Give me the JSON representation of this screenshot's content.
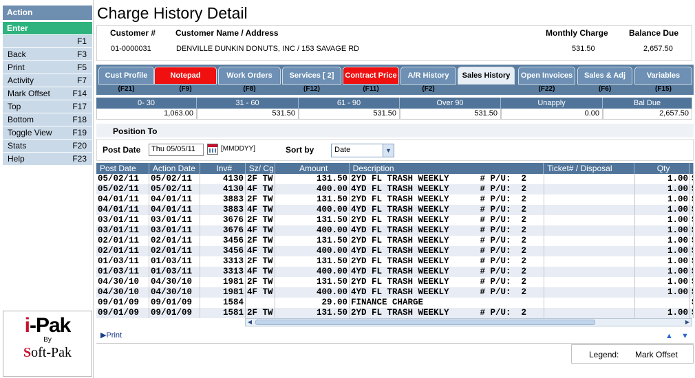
{
  "sidebar": {
    "header": "Action",
    "enter": "Enter",
    "items": [
      {
        "label": "",
        "key": "F1"
      },
      {
        "label": "Back",
        "key": "F3"
      },
      {
        "label": "Print",
        "key": "F5"
      },
      {
        "label": "Activity",
        "key": "F7"
      },
      {
        "label": "Mark Offset",
        "key": "F14"
      },
      {
        "label": "Top",
        "key": "F17"
      },
      {
        "label": "Bottom",
        "key": "F18"
      },
      {
        "label": "Toggle View",
        "key": "F19"
      },
      {
        "label": "Stats",
        "key": "F20"
      },
      {
        "label": "Help",
        "key": "F23"
      }
    ],
    "logo": {
      "brand": "i-Pak",
      "by": "By",
      "maker": "Soft-Pak"
    }
  },
  "page_title": "Charge History Detail",
  "customer": {
    "labels": {
      "number": "Customer #",
      "name": "Customer Name / Address",
      "monthly": "Monthly Charge",
      "balance": "Balance Due"
    },
    "number": "01-0000031",
    "name_address": "DENVILLE DUNKIN DONUTS, INC  /  153 SAVAGE RD",
    "monthly_charge": "531.50",
    "balance_due": "2,657.50"
  },
  "tabs": [
    {
      "label": "Cust Profile",
      "key": "(F21)",
      "style": "normal"
    },
    {
      "label": "Notepad",
      "key": "(F9)",
      "style": "red"
    },
    {
      "label": "Work Orders",
      "key": "(F8)",
      "style": "normal"
    },
    {
      "label": "Services [    2]",
      "key": "(F12)",
      "style": "normal"
    },
    {
      "label": "Contract Price",
      "key": "(F11)",
      "style": "red"
    },
    {
      "label": "A/R History",
      "key": "(F2)",
      "style": "normal"
    },
    {
      "label": "Sales History",
      "key": "",
      "style": "active"
    },
    {
      "label": "Open Invoices",
      "key": "(F22)",
      "style": "normal"
    },
    {
      "label": "Sales & Adj",
      "key": "(F6)",
      "style": "normal"
    },
    {
      "label": "Variables",
      "key": "(F15)",
      "style": "normal"
    }
  ],
  "aging": {
    "headers": [
      "0- 30",
      "31 - 60",
      "61 - 90",
      "Over 90",
      "Unapply",
      "Bal Due"
    ],
    "values": [
      "1,063.00",
      "531.50",
      "531.50",
      "531.50",
      "0.00",
      "2,657.50"
    ]
  },
  "position_to": "Position To",
  "filters": {
    "post_date_label": "Post Date",
    "post_date_value": "Thu 05/05/11",
    "date_format": "[MMDDYY]",
    "sort_label": "Sort by",
    "sort_value": "Date"
  },
  "grid": {
    "headers": [
      "Post Date",
      "Action Date",
      "Inv#",
      "Sz/ Cg",
      "Amount",
      "Description",
      "Ticket# / Disposal",
      "Qty",
      ""
    ],
    "rows": [
      [
        "05/02/11",
        "05/02/11",
        "4130",
        "2F TW",
        "131.50",
        "2YD FL TRASH WEEKLY      # P/U:  2",
        "",
        "1.00",
        "S"
      ],
      [
        "05/02/11",
        "05/02/11",
        "4130",
        "4F TW",
        "400.00",
        "4YD FL TRASH WEEKLY      # P/U:  2",
        "",
        "1.00",
        "S"
      ],
      [
        "04/01/11",
        "04/01/11",
        "3883",
        "2F TW",
        "131.50",
        "2YD FL TRASH WEEKLY      # P/U:  2",
        "",
        "1.00",
        "S"
      ],
      [
        "04/01/11",
        "04/01/11",
        "3883",
        "4F TW",
        "400.00",
        "4YD FL TRASH WEEKLY      # P/U:  2",
        "",
        "1.00",
        "S"
      ],
      [
        "03/01/11",
        "03/01/11",
        "3676",
        "2F TW",
        "131.50",
        "2YD FL TRASH WEEKLY      # P/U:  2",
        "",
        "1.00",
        "S"
      ],
      [
        "03/01/11",
        "03/01/11",
        "3676",
        "4F TW",
        "400.00",
        "4YD FL TRASH WEEKLY      # P/U:  2",
        "",
        "1.00",
        "S"
      ],
      [
        "02/01/11",
        "02/01/11",
        "3456",
        "2F TW",
        "131.50",
        "2YD FL TRASH WEEKLY      # P/U:  2",
        "",
        "1.00",
        "S"
      ],
      [
        "02/01/11",
        "02/01/11",
        "3456",
        "4F TW",
        "400.00",
        "4YD FL TRASH WEEKLY      # P/U:  2",
        "",
        "1.00",
        "S"
      ],
      [
        "01/03/11",
        "01/03/11",
        "3313",
        "2F TW",
        "131.50",
        "2YD FL TRASH WEEKLY      # P/U:  2",
        "",
        "1.00",
        "S"
      ],
      [
        "01/03/11",
        "01/03/11",
        "3313",
        "4F TW",
        "400.00",
        "4YD FL TRASH WEEKLY      # P/U:  2",
        "",
        "1.00",
        "S"
      ],
      [
        "04/30/10",
        "04/30/10",
        "1981",
        "2F TW",
        "131.50",
        "2YD FL TRASH WEEKLY      # P/U:  2",
        "",
        "1.00",
        "S"
      ],
      [
        "04/30/10",
        "04/30/10",
        "1981",
        "4F TW",
        "400.00",
        "4YD FL TRASH WEEKLY      # P/U:  2",
        "",
        "1.00",
        "S"
      ],
      [
        "09/01/09",
        "09/01/09",
        "1584",
        "",
        "29.00",
        "FINANCE CHARGE",
        "",
        "",
        "S"
      ],
      [
        "09/01/09",
        "09/01/09",
        "1581",
        "2F TW",
        "131.50",
        "2YD FL TRASH WEEKLY      # P/U:  2",
        "",
        "1.00",
        "S"
      ]
    ]
  },
  "footer": {
    "print": "Print",
    "legend_label": "Legend:",
    "legend_value": "Mark Offset"
  },
  "colors": {
    "header_blue": "#51759a",
    "enter_green": "#2fb37e",
    "alert_red": "#f01010",
    "sidebar_item": "#c9d9e8"
  }
}
